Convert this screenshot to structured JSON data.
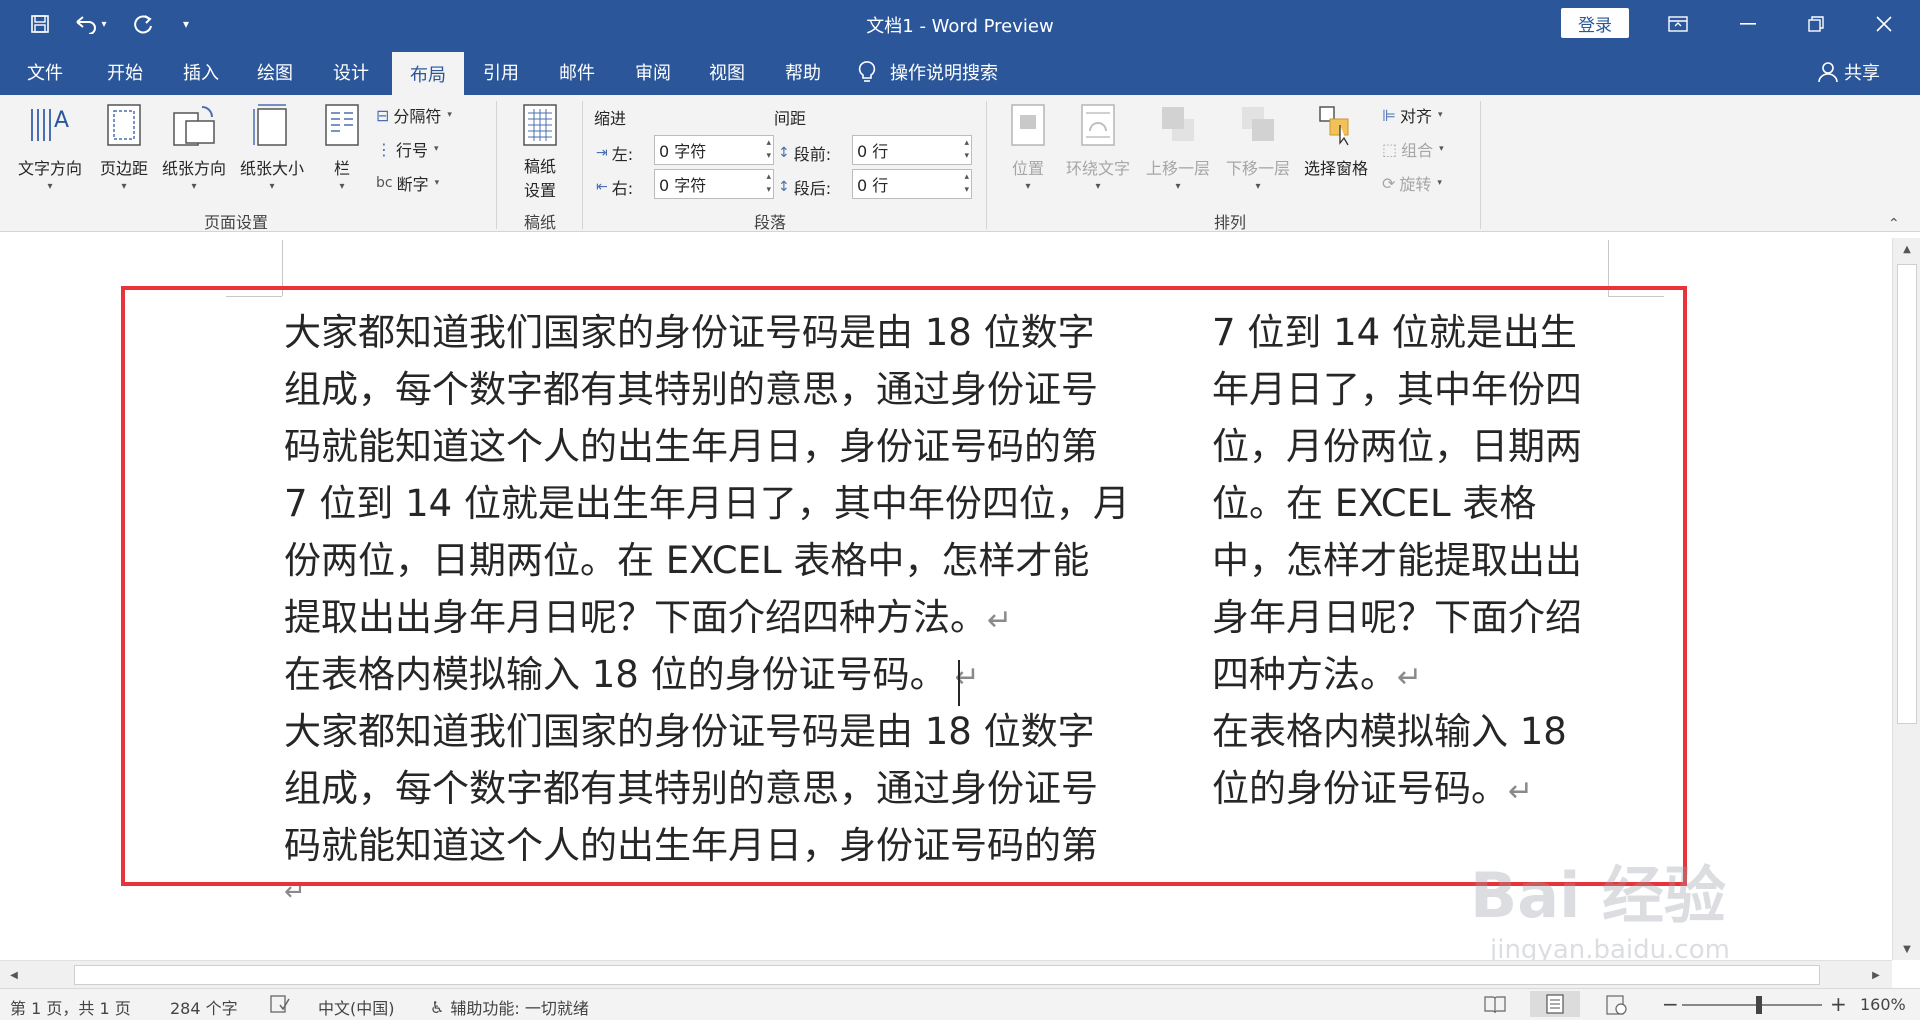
{
  "window": {
    "title": "文档1  -  Word Preview",
    "login_label": "登录"
  },
  "tabs": [
    "文件",
    "开始",
    "插入",
    "绘图",
    "设计",
    "布局",
    "引用",
    "邮件",
    "审阅",
    "视图",
    "帮助"
  ],
  "active_tab": "布局",
  "search_label": "操作说明搜索",
  "share_label": "共享",
  "ribbon": {
    "page_setup": {
      "text_direction": "文字方向",
      "margins": "页边距",
      "orientation": "纸张方向",
      "size": "纸张大小",
      "columns": "栏",
      "breaks": "分隔符",
      "line_numbers": "行号",
      "hyphenation": "断字",
      "group_label": "页面设置"
    },
    "manuscript": {
      "button_line1": "稿纸",
      "button_line2": "设置",
      "group_label": "稿纸"
    },
    "paragraph": {
      "indent_title": "缩进",
      "spacing_title": "间距",
      "left_label": "左:",
      "right_label": "右:",
      "left_value": "0 字符",
      "right_value": "0 字符",
      "before_label": "段前:",
      "after_label": "段后:",
      "before_value": "0 行",
      "after_value": "0 行",
      "group_label": "段落"
    },
    "arrange": {
      "position": "位置",
      "wrap_text": "环绕文字",
      "bring_forward": "上移一层",
      "send_backward": "下移一层",
      "selection_pane": "选择窗格",
      "align": "对齐",
      "group": "组合",
      "rotate": "旋转",
      "group_label": "排列"
    }
  },
  "document": {
    "left_column": [
      "大家都知道我们国家的身份证号码是由 18 位数字",
      "组成，每个数字都有其特别的意思，通过身份证号",
      "码就能知道这个人的出生年月日，身份证号码的第",
      "7 位到 14 位就是出生年月日了，其中年份四位，月",
      "份两位，日期两位。在 EXCEL 表格中，怎样才能",
      "提取出出身年月日呢？下面介绍四种方法。",
      "在表格内模拟输入 18 位的身份证号码。",
      "大家都知道我们国家的身份证号码是由 18 位数字",
      "组成，每个数字都有其特别的意思，通过身份证号",
      "码就能知道这个人的出生年月日，身份证号码的第"
    ],
    "right_column": [
      "7 位到 14 位就是出生",
      "年月日了，其中年份四",
      "位，月份两位，日期两",
      "位。在 EXCEL 表格",
      "中，怎样才能提取出出",
      "身年月日呢？下面介绍",
      "四种方法。",
      "在表格内模拟输入 18",
      "位的身份证号码。"
    ],
    "paragraph_mark": "↵"
  },
  "status": {
    "page": "第 1 页，共 1 页",
    "words": "284 个字",
    "language": "中文(中国)",
    "accessibility": "辅助功能: 一切就绪",
    "zoom": "160%",
    "zoom_minus": "−",
    "zoom_plus": "+"
  },
  "watermark": {
    "text": "Bai 经验",
    "sub": "jingyan.baidu.com"
  },
  "colors": {
    "brand": "#2b579a",
    "highlight_box": "#e8333a"
  }
}
